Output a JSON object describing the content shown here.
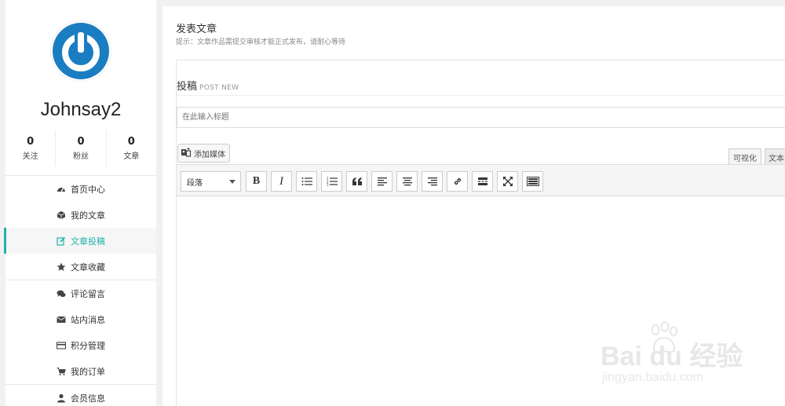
{
  "profile": {
    "username": "Johnsay2",
    "stats": [
      {
        "value": "0",
        "label": "关注"
      },
      {
        "value": "0",
        "label": "粉丝"
      },
      {
        "value": "0",
        "label": "文章"
      }
    ]
  },
  "menu": {
    "items": [
      {
        "label": "首页中心",
        "icon": "dashboard-icon"
      },
      {
        "label": "我的文章",
        "icon": "cube-icon"
      },
      {
        "label": "文章投稿",
        "icon": "edit-icon",
        "active": true
      },
      {
        "label": "文章收藏",
        "icon": "star-icon"
      },
      {
        "label": "评论留言",
        "icon": "comments-icon"
      },
      {
        "label": "站内消息",
        "icon": "envelope-icon"
      },
      {
        "label": "积分管理",
        "icon": "credit-card-icon"
      },
      {
        "label": "我的订单",
        "icon": "cart-icon"
      },
      {
        "label": "会员信息",
        "icon": "user-icon"
      }
    ]
  },
  "main": {
    "title": "发表文章",
    "hint": "提示：文章作品需提交审核才能正式发布，请耐心等待"
  },
  "post": {
    "heading": "投稿",
    "heading_sub": "POST NEW",
    "title_placeholder": "在此输入标题",
    "add_media_label": "添加媒体",
    "tab_visual": "可视化",
    "tab_text": "文本",
    "format_value": "段落"
  },
  "watermark": {
    "brand": "Bai du 经验",
    "url": "jingyan.baidu.com"
  },
  "colors": {
    "accent": "#1fb3a6",
    "avatar_blue": "#1b7dc1"
  }
}
